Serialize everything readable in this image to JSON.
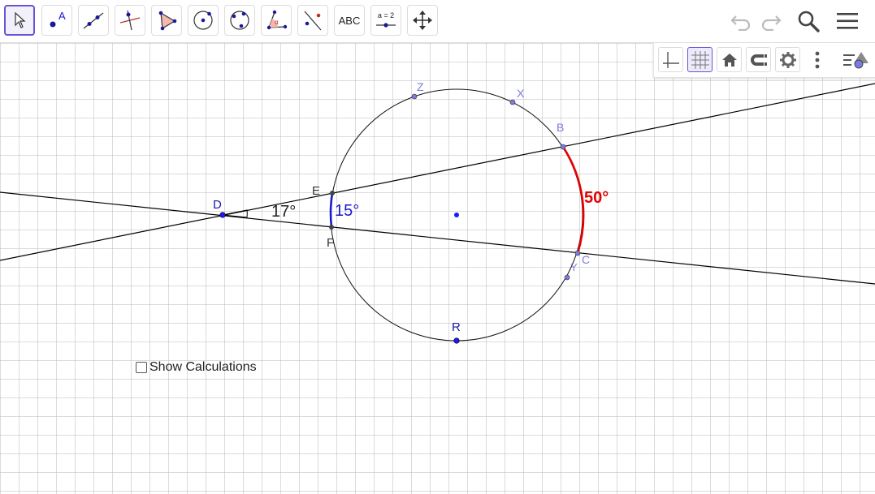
{
  "toolbar": {
    "tools": [
      {
        "name": "move-tool",
        "icon": "arrow-cursor-icon"
      },
      {
        "name": "point-tool",
        "icon": "point-icon",
        "glyph": "A"
      },
      {
        "name": "line-tool",
        "icon": "line-through-two-points-icon"
      },
      {
        "name": "perpendicular-line-tool",
        "icon": "perpendicular-line-icon"
      },
      {
        "name": "polygon-tool",
        "icon": "polygon-icon"
      },
      {
        "name": "circle-center-point-tool",
        "icon": "circle-center-point-icon"
      },
      {
        "name": "circle-three-points-tool",
        "icon": "circle-three-points-icon"
      },
      {
        "name": "angle-tool",
        "icon": "angle-icon",
        "glyph": "α"
      },
      {
        "name": "reflect-tool",
        "icon": "reflect-about-line-icon"
      },
      {
        "name": "text-tool",
        "icon": "text-icon",
        "glyph": "ABC"
      },
      {
        "name": "slider-tool",
        "icon": "slider-icon",
        "glyph": "a = 2"
      },
      {
        "name": "move-graphics-view-tool",
        "icon": "move-arrows-icon"
      }
    ],
    "right_icons": [
      "undo-icon",
      "redo-icon",
      "search-icon",
      "menu-icon"
    ]
  },
  "style_bar": {
    "buttons": [
      "axes-icon",
      "grid-icon",
      "home-icon",
      "point-capturing-icon",
      "settings-icon",
      "more-vertical-icon"
    ],
    "toggle_icon": "style-bar-toggle-icon"
  },
  "graphics": {
    "points": {
      "D": "D",
      "E": "E",
      "F": "F",
      "B": "B",
      "C": "C",
      "Z": "Z",
      "X": "X",
      "Y": "Y",
      "R": "R"
    },
    "angles": {
      "vertex_angle": "17°",
      "minor_arc_angle": "15°",
      "major_arc_angle": "50°"
    },
    "colors": {
      "free_point": "#1a1aff",
      "dependent_point": "#333333",
      "circle_point": "#7b7be0",
      "arc_blue": "#1a1acc",
      "arc_red": "#e60000",
      "selected_tool": "#6557d2"
    }
  },
  "checkbox": {
    "label": "Show Calculations",
    "checked": false
  }
}
